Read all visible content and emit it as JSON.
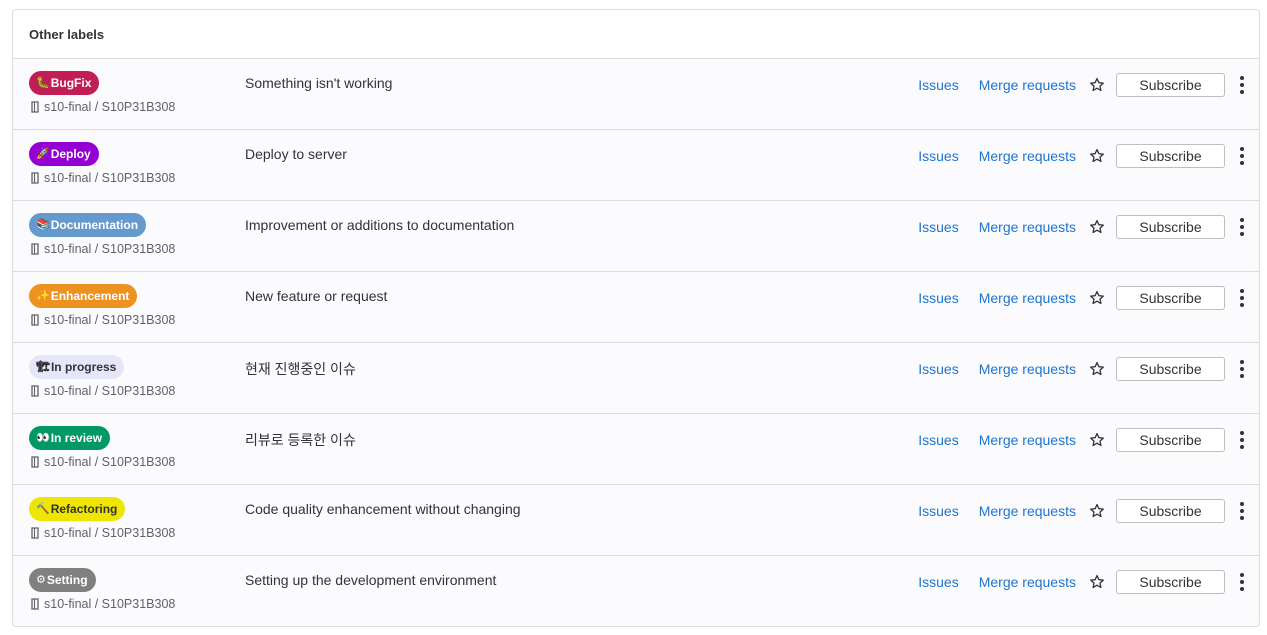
{
  "header": {
    "title": "Other labels"
  },
  "actions": {
    "issues_label": "Issues",
    "merge_requests_label": "Merge requests",
    "subscribe_label": "Subscribe"
  },
  "labels": [
    {
      "emoji": "🐛",
      "name": "BugFix",
      "bg": "#c21e56",
      "fg": "#ffffff",
      "project": "s10-final / S10P31B308",
      "description": "Something isn't working"
    },
    {
      "emoji": "🚀",
      "name": "Deploy",
      "bg": "#9400d3",
      "fg": "#ffffff",
      "project": "s10-final / S10P31B308",
      "description": "Deploy to server"
    },
    {
      "emoji": "📚",
      "name": "Documentation",
      "bg": "#6699cc",
      "fg": "#ffffff",
      "project": "s10-final / S10P31B308",
      "description": "Improvement or additions to documentation"
    },
    {
      "emoji": "✨",
      "name": "Enhancement",
      "bg": "#ed9121",
      "fg": "#ffffff",
      "project": "s10-final / S10P31B308",
      "description": "New feature or request"
    },
    {
      "emoji": "🏗",
      "name": "In progress",
      "bg": "#e6e6fa",
      "fg": "#333238",
      "project": "s10-final / S10P31B308",
      "description": "현재 진행중인 이슈"
    },
    {
      "emoji": "👀",
      "name": "In review",
      "bg": "#009966",
      "fg": "#ffffff",
      "project": "s10-final / S10P31B308",
      "description": "리뷰로 등록한 이슈"
    },
    {
      "emoji": "🔨",
      "name": "Refactoring",
      "bg": "#eee600",
      "fg": "#333238",
      "project": "s10-final / S10P31B308",
      "description": "Code quality enhancement without changing"
    },
    {
      "emoji": "⚙",
      "name": "Setting",
      "bg": "#808080",
      "fg": "#ffffff",
      "project": "s10-final / S10P31B308",
      "description": "Setting up the development environment"
    }
  ],
  "icons": {
    "project": "project-box-icon",
    "star": "star-icon",
    "more": "kebab-menu-icon"
  },
  "colors": {
    "link": "#1f75cb",
    "border": "#dcdcde",
    "row_bg": "#fbfafd"
  }
}
